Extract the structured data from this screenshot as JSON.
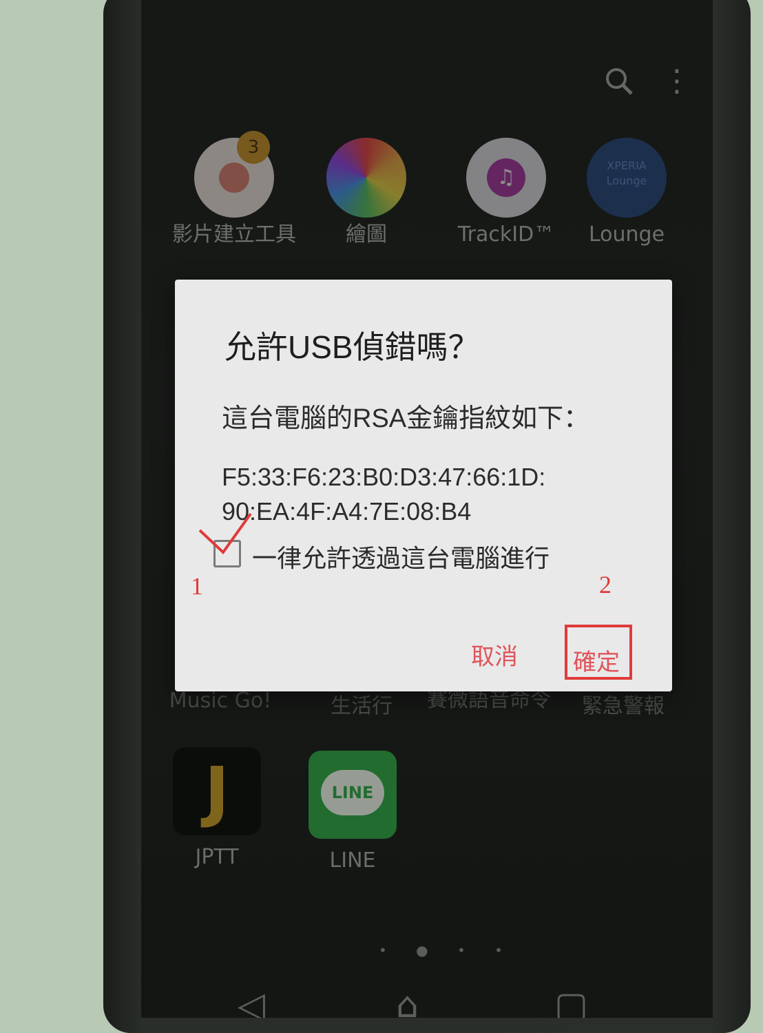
{
  "launcher": {
    "badge_count": "3",
    "apps_top": [
      {
        "label": "影片建立工具"
      },
      {
        "label": "繪圖"
      },
      {
        "label": "TrackID™"
      },
      {
        "label": "Lounge",
        "icon_text": "XPERIA Lounge"
      }
    ],
    "apps_row2": [
      "Music Go!",
      "生活行",
      "賽微語音命令",
      "緊急警報"
    ],
    "apps_bottom": [
      {
        "label": "JPTT",
        "icon_text": "J"
      },
      {
        "label": "LINE",
        "icon_text": "LINE"
      }
    ],
    "page_indicator": "• ● • •"
  },
  "dialog": {
    "title": "允許USB偵錯嗎？",
    "message": "這台電腦的RSA金鑰指紋如下：",
    "fingerprint_line1": "F5:33:F6:23:B0:D3:47:66:1D:",
    "fingerprint_line2": "90:EA:4F:A4:7E:08:B4",
    "checkbox_label": "一律允許透過這台電腦進行",
    "checkbox_checked": false,
    "cancel_label": "取消",
    "ok_label": "確定",
    "button_color": "#e0545a"
  },
  "annotations": {
    "step1": "1",
    "step2": "2",
    "color": "#e03a3a"
  },
  "navbar": {
    "back_icon": "back-triangle-icon",
    "home_icon": "home-icon",
    "recent_icon": "recent-apps-icon"
  }
}
